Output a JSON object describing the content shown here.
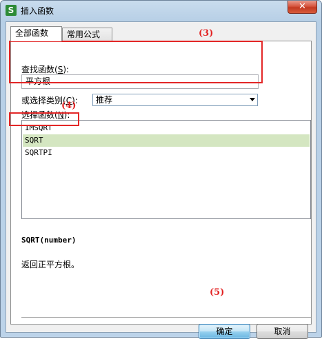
{
  "window": {
    "title": "插入函数",
    "app_icon_glyph": "S",
    "close_glyph": "✕"
  },
  "tabs": [
    {
      "label": "全部函数",
      "active": true
    },
    {
      "label": "常用公式",
      "active": false
    }
  ],
  "search": {
    "label_prefix": "查找函数(",
    "label_mnemonic": "S",
    "label_suffix": "):",
    "value": "平方根"
  },
  "category": {
    "label_prefix": "或选择类别(",
    "label_mnemonic": "C",
    "label_suffix": "):",
    "selected": "推荐"
  },
  "functions": {
    "label_prefix": "选择函数(",
    "label_mnemonic": "N",
    "label_suffix": "):",
    "items": [
      {
        "name": "IMSQRT",
        "selected": false
      },
      {
        "name": "SQRT",
        "selected": true
      },
      {
        "name": "SQRTPI",
        "selected": false
      }
    ]
  },
  "details": {
    "signature": "SQRT(number)",
    "description": "返回正平方根。"
  },
  "buttons": {
    "ok": "确定",
    "cancel": "取消"
  },
  "annotations": {
    "a3": "(3)",
    "a4": "(4)",
    "a5": "(5)"
  },
  "colors": {
    "annotation": "#e32626",
    "selection": "#d4e6c1",
    "app_icon": "#2e8b37"
  }
}
